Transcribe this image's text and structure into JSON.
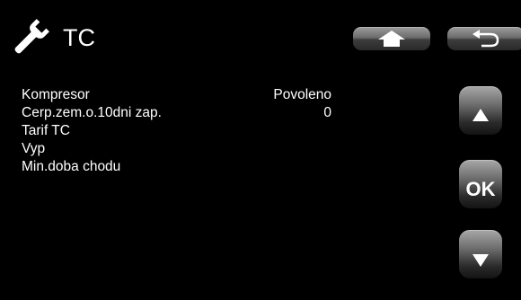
{
  "header": {
    "icon": "wrench-icon",
    "title": "TC"
  },
  "buttons": {
    "home_icon": "home-icon",
    "back_icon": "back-arrow-icon",
    "up_icon": "triangle-up-icon",
    "ok_label": "OK",
    "down_icon": "triangle-down-icon"
  },
  "menu": {
    "items": [
      {
        "label": "Kompresor",
        "value": "Povoleno"
      },
      {
        "label": "Cerp.zem.o.10dni zap.",
        "value": "0"
      },
      {
        "label": "Tarif TC",
        "value": ""
      },
      {
        "label": "Vyp",
        "value": ""
      },
      {
        "label": "Min.doba chodu",
        "value": ""
      }
    ]
  }
}
